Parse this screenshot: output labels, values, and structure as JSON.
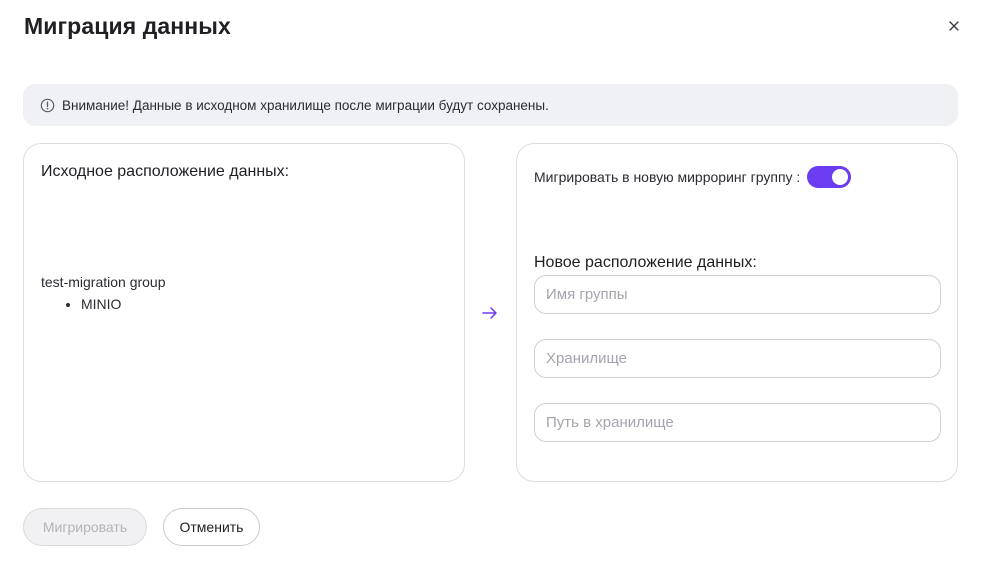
{
  "dialog": {
    "title": "Миграция данных",
    "close_icon": "close-icon"
  },
  "alert": {
    "icon": "info-circle-icon",
    "text": "Внимание! Данные в исходном хранилище после миграции будут сохранены."
  },
  "source": {
    "heading": "Исходное расположение данных:",
    "group_name": "test-migration group",
    "storages": [
      "MINIO"
    ]
  },
  "arrow_icon": "arrow-right-icon",
  "target": {
    "toggle_label": "Мигрировать в новую мирроринг группу :",
    "toggle_on": true,
    "heading": "Новое расположение данных:",
    "group_placeholder": "Имя группы",
    "storage_placeholder": "Хранилище",
    "path_placeholder": "Путь в хранилище"
  },
  "actions": {
    "migrate_label": "Мигрировать",
    "cancel_label": "Отменить"
  },
  "colors": {
    "accent": "#6c3cf0",
    "alert_bg": "#eff1f4"
  }
}
